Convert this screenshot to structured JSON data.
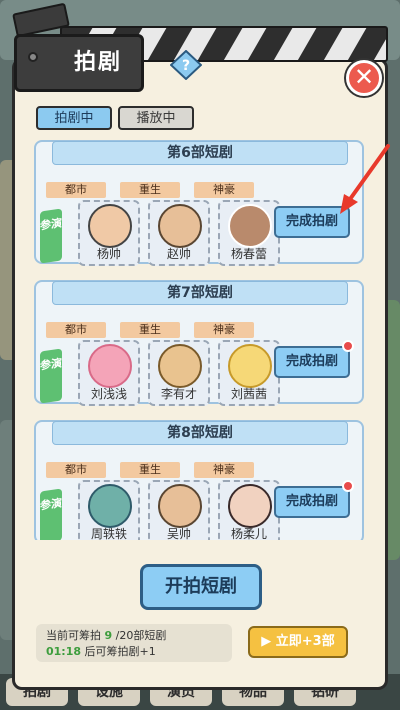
{
  "header": {
    "title": "拍剧"
  },
  "tabs": [
    {
      "label": "拍剧中"
    },
    {
      "label": "播放中"
    }
  ],
  "dramas": [
    {
      "title": "第6部短剧",
      "genres": [
        "都市",
        "重生",
        "神豪"
      ],
      "cast_label": "参演",
      "actors": [
        "杨帅",
        "赵帅",
        "杨春蕾"
      ],
      "button": "完成拍剧"
    },
    {
      "title": "第7部短剧",
      "genres": [
        "都市",
        "重生",
        "神豪"
      ],
      "cast_label": "参演",
      "actors": [
        "刘浅浅",
        "李有才",
        "刘茜茜"
      ],
      "button": "完成拍剧"
    },
    {
      "title": "第8部短剧",
      "genres": [
        "都市",
        "重生",
        "神豪"
      ],
      "cast_label": "参演",
      "actors": [
        "周轶轶",
        "吴帅",
        "杨柔儿"
      ],
      "button": "完成拍剧"
    }
  ],
  "start_button": "开拍短剧",
  "info": {
    "line1_prefix": "当前可筹拍",
    "current": "9",
    "line1_suffix": "/20部短剧",
    "timer": "01:18",
    "line2_suffix": "后可筹拍剧+1"
  },
  "video_button": "立即+3部",
  "bottom_tabs": [
    "拍剧",
    "设施",
    "演员",
    "物品",
    "钻研"
  ],
  "colors": {
    "accent": "#8dcdf4",
    "close": "#ec5a4e",
    "video": "#f5c141",
    "cast": "#5ec072"
  }
}
